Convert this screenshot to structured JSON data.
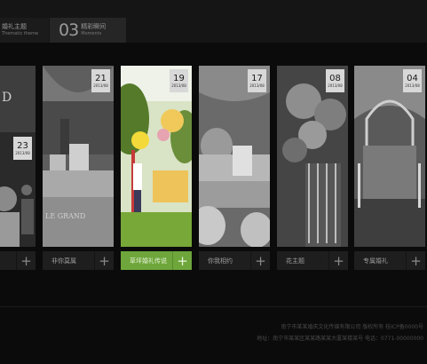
{
  "nav": {
    "prev": {
      "num": "",
      "cn": "婚礼主题",
      "en": "Thematic theme"
    },
    "current": {
      "num": "03",
      "cn": "精彩瞬间",
      "en": "Moments"
    }
  },
  "panels": [
    {
      "caption": "非你莫属",
      "day": "23",
      "ym": "2013/08",
      "logo": "D"
    },
    {
      "caption": "非你莫属",
      "day": "21",
      "ym": "2013/08"
    },
    {
      "caption": "草坪婚礼传说",
      "day": "19",
      "ym": "2013/08",
      "active": true
    },
    {
      "caption": "你我相约",
      "day": "17",
      "ym": "2013/08"
    },
    {
      "caption": "花主题",
      "day": "08",
      "ym": "2013/08"
    },
    {
      "caption": "专属婚礼",
      "day": "04",
      "ym": "2013/08"
    }
  ],
  "plus_symbol": "+",
  "footer": {
    "line1": "南宁市某某婚庆文化传媒有限公司  版权所有  桂ICP备0000号",
    "line2": "地址：南宁市某某区某某路某某大厦某楼某号  电话：0771-00000000"
  },
  "colors": {
    "active_caption": "#6ea63b",
    "caption_bg": "#1e1e1e",
    "date_box": "#d8d8d8"
  }
}
